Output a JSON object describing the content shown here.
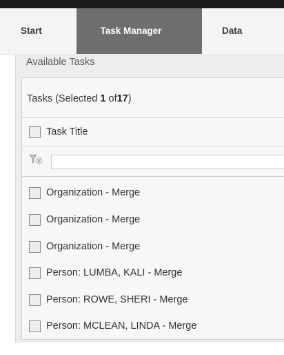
{
  "tabs": [
    {
      "label": "Start"
    },
    {
      "label": "Task Manager"
    },
    {
      "label": "Data"
    }
  ],
  "panel": {
    "title": "Available Tasks",
    "tasks_header": {
      "prefix": "Tasks (",
      "selected_word": "Selected",
      "selected_count": "1",
      "of_word": "of",
      "total": "17",
      "suffix": ")"
    },
    "column_header": "Task Title",
    "filter": {
      "value": "",
      "icon": "filter-clear-icon"
    },
    "tasks": [
      {
        "title": "Organization - Merge"
      },
      {
        "title": "Organization - Merge"
      },
      {
        "title": "Organization - Merge"
      },
      {
        "title": "Person: LUMBA, KALI - Merge"
      },
      {
        "title": "Person: ROWE, SHERI - Merge"
      },
      {
        "title": "Person: MCLEAN, LINDA - Merge"
      }
    ]
  },
  "colors": {
    "active_tab": "#6e6e6e",
    "top_bar": "#1a1a1a",
    "panel_bg": "#ededed"
  }
}
